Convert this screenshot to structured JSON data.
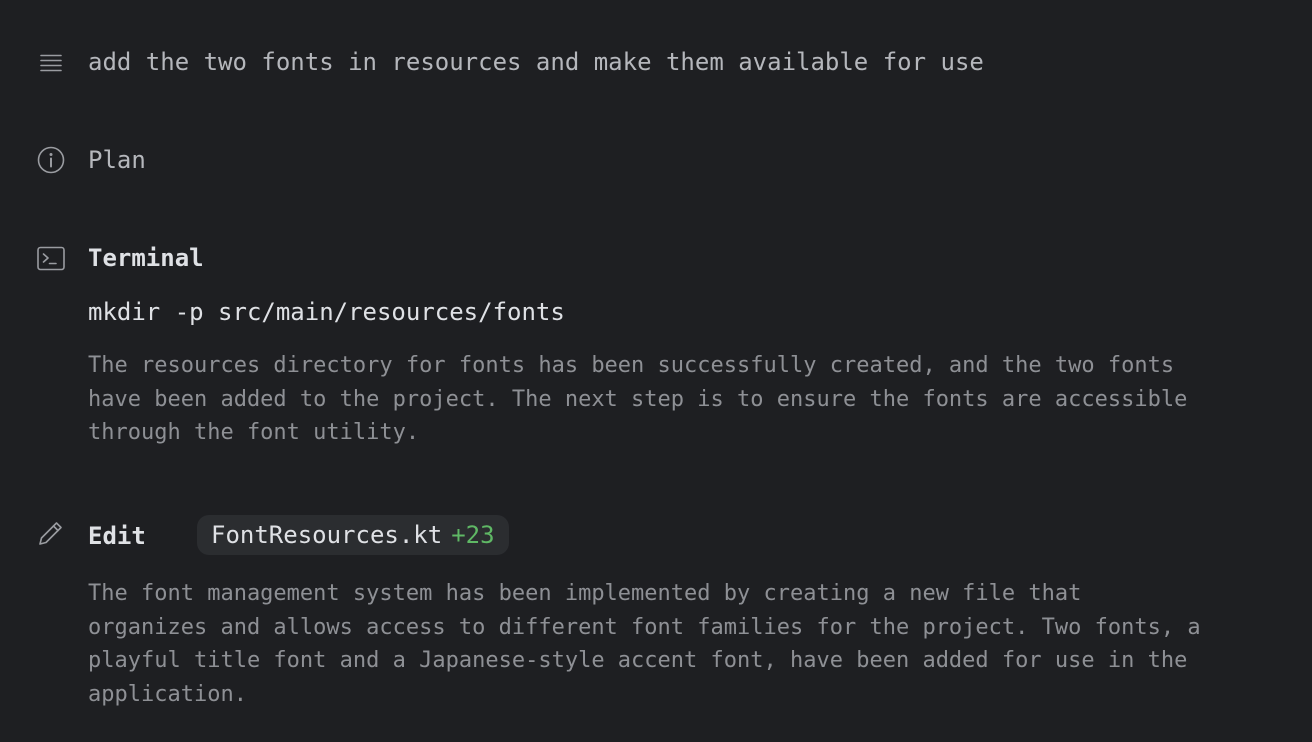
{
  "prompt": {
    "icon": "list-icon",
    "text": "add the two fonts in resources and make them available for use"
  },
  "plan": {
    "icon": "info-icon",
    "label": "Plan"
  },
  "terminal": {
    "icon": "terminal-icon",
    "label": "Terminal",
    "command": "mkdir -p src/main/resources/fonts",
    "summary": "The resources directory for fonts has been successfully created, and the two fonts\nhave been added to the project. The next step is to ensure the fonts are accessible\nthrough the font utility."
  },
  "edit": {
    "icon": "pencil-icon",
    "label": "Edit",
    "file_name": "FontResources.kt",
    "diff": "+23",
    "summary": "The font management system has been implemented by creating a new file that\norganizes and allows access to different font families for the project. Two fonts, a\nplayful title font and a Japanese-style accent font, have been added for use in the\napplication."
  },
  "colors": {
    "background": "#1e1f22",
    "chip_background": "#2b2d30",
    "diff_added": "#5fb865",
    "text_primary": "#dfe1e5",
    "text_secondary": "#8e9095"
  }
}
